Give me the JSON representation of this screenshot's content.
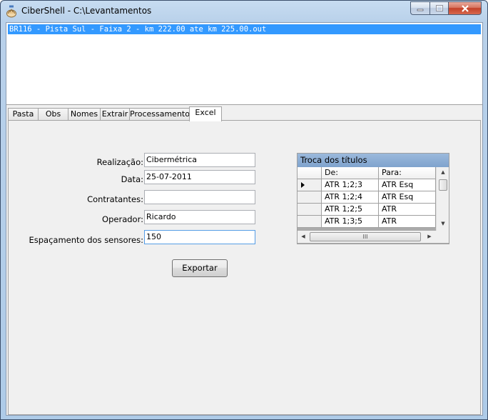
{
  "window": {
    "title": "CiberShell - C:\\Levantamentos"
  },
  "files": [
    "BR116 - Pista Sul - Faixa 2 - km 222.00 ate km 225.00.out"
  ],
  "tabs": [
    "Pasta",
    "Obs",
    "Nomes",
    "Extrair",
    "Processamento",
    "Excel"
  ],
  "active_tab": "Excel",
  "form": {
    "realizacao_label": "Realização:",
    "realizacao_value": "Cibermétrica",
    "data_label": "Data:",
    "data_value": "25-07-2011",
    "contratantes_label": "Contratantes:",
    "contratantes_value": "",
    "operador_label": "Operador:",
    "operador_value": "Ricardo",
    "espacamento_label": "Espaçamento dos sensores:",
    "espacamento_value": "150",
    "export_label": "Exportar"
  },
  "grid": {
    "caption": "Troca dos títulos",
    "columns": [
      "De:",
      "Para:"
    ],
    "rows": [
      [
        "ATR 1;2;3",
        "ATR Esq"
      ],
      [
        "ATR 1;2;4",
        "ATR Esq"
      ],
      [
        "ATR 1;2;5",
        "ATR"
      ],
      [
        "ATR 1;3;5",
        "ATR"
      ]
    ],
    "scroll_glyph": "III"
  },
  "icons": {
    "app": "shell-app-icon",
    "current_row": "row-pointer-icon"
  }
}
